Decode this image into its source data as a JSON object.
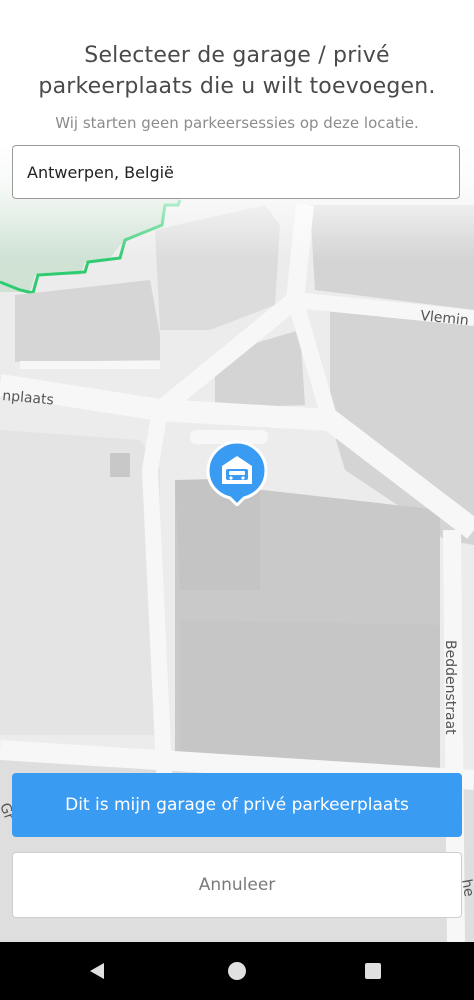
{
  "header": {
    "title_line1": "Selecteer de garage / privé",
    "title_line2": "parkeerplaats die u wilt toevoegen.",
    "subtitle": "Wij starten geen parkeersessies op deze locatie."
  },
  "search": {
    "value": "Antwerpen, België"
  },
  "map": {
    "street_labels": {
      "left": "nplaats",
      "top_right": "Vlemin",
      "right_vertical": "Beddenstraat",
      "bottom_left": "Gr",
      "bottom_right": "he"
    },
    "marker_icon": "garage-car-icon",
    "marker_color": "#3a9bf2",
    "boundary_color": "#2ecc71"
  },
  "actions": {
    "confirm_label": "Dit is mijn garage of privé parkeerplaats",
    "cancel_label": "Annuleer"
  },
  "navbar": {
    "icons": [
      "back-icon",
      "home-icon",
      "recent-apps-icon"
    ]
  }
}
